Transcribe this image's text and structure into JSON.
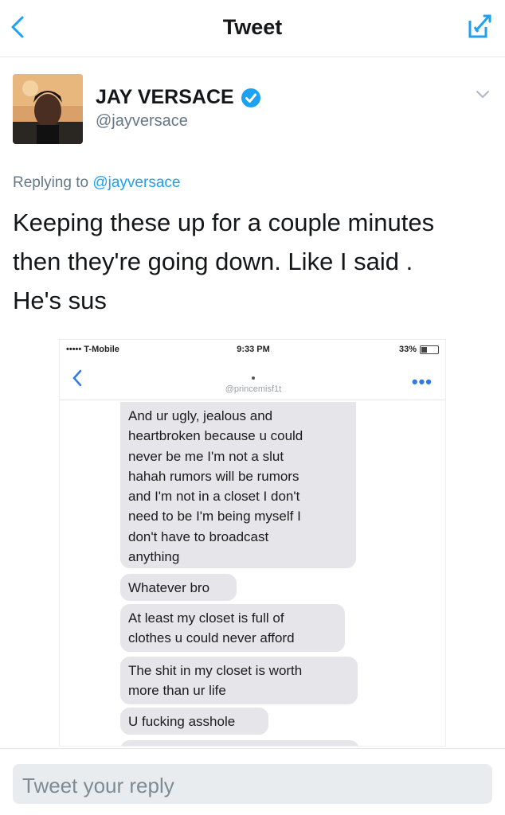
{
  "nav": {
    "title": "Tweet",
    "back_icon": "chevron-left-icon",
    "compose_icon": "compose-icon",
    "accent": "#1da1f2"
  },
  "tweet": {
    "display_name": "JAY VERSACE",
    "verified_icon": "verified-badge-icon",
    "handle": "@jayversace",
    "replying_prefix": "Replying to",
    "replying_to": "@jayversace",
    "text_lines": [
      "Keeping these up for a couple minutes",
      "then they're going down. Like I said .",
      "He's sus"
    ]
  },
  "screenshot": {
    "carrier": "••••• T-Mobile",
    "time": "9:33 PM",
    "battery": "33%",
    "contact": "@princemisf1t",
    "messages": [
      [
        "And ur ugly, jealous and",
        "heartbroken because u could",
        "never be me I'm not a slut",
        "hahah rumors will be rumors",
        "and I'm not in a closet I don't",
        "need to be I'm being myself I",
        "don't have to broadcast",
        "anything"
      ],
      [
        "Whatever bro"
      ],
      [
        "At least my closet is full of",
        "clothes u could never afford"
      ],
      [
        "The shit in my closet is worth",
        "more than ur life"
      ],
      [
        "U fucking asshole"
      ]
    ]
  },
  "reply": {
    "placeholder": "Tweet your reply"
  }
}
